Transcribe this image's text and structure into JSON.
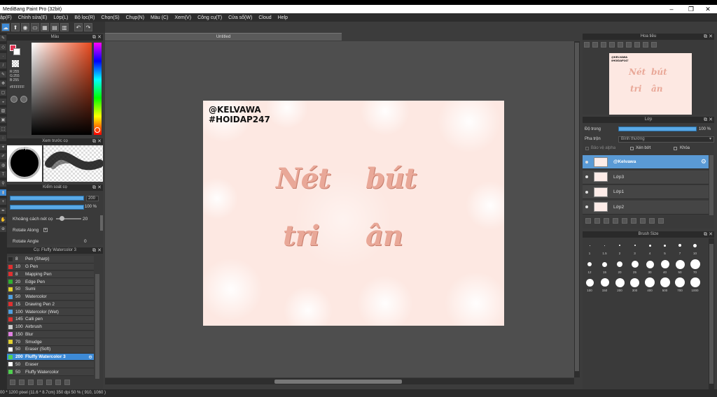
{
  "window": {
    "title": "MediBang Paint Pro (32bit)",
    "minimize": "–",
    "maximize": "❐",
    "close": "✕"
  },
  "menu": [
    "ập(F)",
    "Chỉnh sửa(E)",
    "Lớp(L)",
    "Bộ lọc(R)",
    "Chọn(S)",
    "Chụp(N)",
    "Màu (C)",
    "Xem(V)",
    "Công cụ(T)",
    "Cửa sổ(W)",
    "Cloud",
    "Help"
  ],
  "color_panel": {
    "title": "Màu",
    "r": "R:255",
    "g": "G:255",
    "b": "B:255",
    "hex": "#FFFFFF",
    "accent": "#e06040"
  },
  "preview_panel": {
    "title": "Xem trước cọ",
    "size_label": "200 pixel"
  },
  "brush_control": {
    "title": "Kiểm soát cọ",
    "size_value": "200",
    "opacity_value": "100 %",
    "spacing_label": "Khoảng cách nét cọ",
    "spacing_value": "20",
    "rotate_along_label": "Rotate Along",
    "rotate_angle_label": "Rotate Angle",
    "rotate_angle_value": "0",
    "size_fraction": 1.0,
    "opacity_fraction": 1.0
  },
  "brush_list": {
    "title": "Cọ: Fluffy Watercolor 3",
    "items": [
      {
        "size": "8",
        "name": "Pen (Sharp)",
        "color": "#2a2a2a"
      },
      {
        "size": "10",
        "name": "G Pen",
        "color": "#e03030"
      },
      {
        "size": "8",
        "name": "Mapping Pen",
        "color": "#e03030"
      },
      {
        "size": "20",
        "name": "Edge Pen",
        "color": "#30b030"
      },
      {
        "size": "50",
        "name": "Sumi",
        "color": "#e0d030"
      },
      {
        "size": "50",
        "name": "Watercolor",
        "color": "#50a0e0"
      },
      {
        "size": "15",
        "name": "Drawing Pen 2",
        "color": "#e03030"
      },
      {
        "size": "100",
        "name": "Watercolor (Wet)",
        "color": "#50a0e0"
      },
      {
        "size": "145",
        "name": "Calli pen",
        "color": "#e03030"
      },
      {
        "size": "100",
        "name": "Airbrush",
        "color": "#cccccc"
      },
      {
        "size": "150",
        "name": "Blur",
        "color": "#e080e0"
      },
      {
        "size": "70",
        "name": "Smudge",
        "color": "#e0d030"
      },
      {
        "size": "50",
        "name": "Eraser (Soft)",
        "color": "#ffffff"
      },
      {
        "size": "200",
        "name": "Fluffy Watercolor 3",
        "color": "#50d050"
      },
      {
        "size": "50",
        "name": "Eraser",
        "color": "#ffffff"
      },
      {
        "size": "50",
        "name": "Fluffy Watercolor",
        "color": "#50d050"
      }
    ]
  },
  "canvas": {
    "tab_title": "Untitled",
    "line1": "@KELVAWA",
    "line2": "#HOIDAP247",
    "script1a": "Nét",
    "script1b": "bút",
    "script2a": "tri",
    "script2b": "ân"
  },
  "navigator": {
    "title": "Hoa tiêu"
  },
  "layers": {
    "title": "Lớp",
    "opacity_label": "Độ trong",
    "opacity_value": "100 %",
    "opacity_fraction": 1.0,
    "blend_label": "Pha trộn",
    "blend_value": "Bình thường",
    "protect_alpha": "Bảo vệ alpha",
    "clipping": "Xén bớt",
    "lock": "Khóa",
    "items": [
      {
        "name": "@Kelvawa",
        "selected": true
      },
      {
        "name": "Lớp3",
        "selected": false
      },
      {
        "name": "Lớp1",
        "selected": false
      },
      {
        "name": "Lớp2",
        "selected": false
      }
    ]
  },
  "brush_size_panel": {
    "title": "Brush Size",
    "row1": [
      "1",
      "1.5",
      "2",
      "3",
      "4",
      "5",
      "7",
      "10"
    ],
    "row2": [
      "12",
      "15",
      "20",
      "25",
      "30",
      "40",
      "50",
      "70"
    ],
    "row3": [
      "100",
      "150",
      "200",
      "300",
      "400",
      "500",
      "700",
      "1000"
    ]
  },
  "status": {
    "text": "00 * 1200 pixel   (11.6 * 8.7cm)   350 dpi   50 %   ( 910, 1060 )"
  }
}
